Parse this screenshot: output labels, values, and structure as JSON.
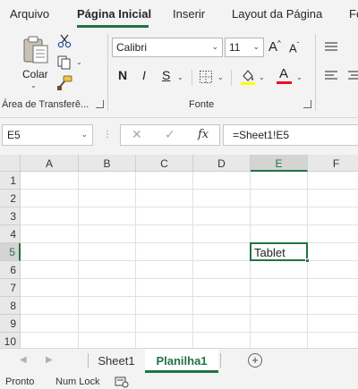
{
  "menu": {
    "tabs": [
      {
        "label": "Arquivo",
        "active": false
      },
      {
        "label": "Página Inicial",
        "active": true
      },
      {
        "label": "Inserir",
        "active": false
      },
      {
        "label": "Layout da Página",
        "active": false
      },
      {
        "label": "Fó",
        "active": false
      }
    ],
    "accent": "#217346"
  },
  "ribbon": {
    "clipboard": {
      "paste_label": "Colar",
      "group_label": "Área de Transferê..."
    },
    "font": {
      "name": "Calibri",
      "size": "11",
      "grow_label": "A",
      "shrink_label": "A",
      "bold_label": "N",
      "italic_label": "I",
      "underline_label": "S",
      "font_color_label": "A",
      "font_color": "#e81123",
      "group_label": "Fonte"
    }
  },
  "formula_bar": {
    "name_box": "E5",
    "fx_label": "fx",
    "formula": "=Sheet1!E5"
  },
  "grid": {
    "columns": [
      "A",
      "B",
      "C",
      "D",
      "E",
      "F"
    ],
    "rows": [
      "1",
      "2",
      "3",
      "4",
      "5",
      "6",
      "7",
      "8",
      "9",
      "10"
    ],
    "selected_column": "E",
    "selected_row": "5",
    "cells": [
      {
        "ref": "E5",
        "value": "Tablet"
      }
    ]
  },
  "sheets": {
    "tabs": [
      {
        "label": "Sheet1",
        "active": false
      },
      {
        "label": "Planilha1",
        "active": true
      }
    ],
    "add_label": "+"
  },
  "status_bar": {
    "ready": "Pronto",
    "num_lock": "Num Lock"
  }
}
